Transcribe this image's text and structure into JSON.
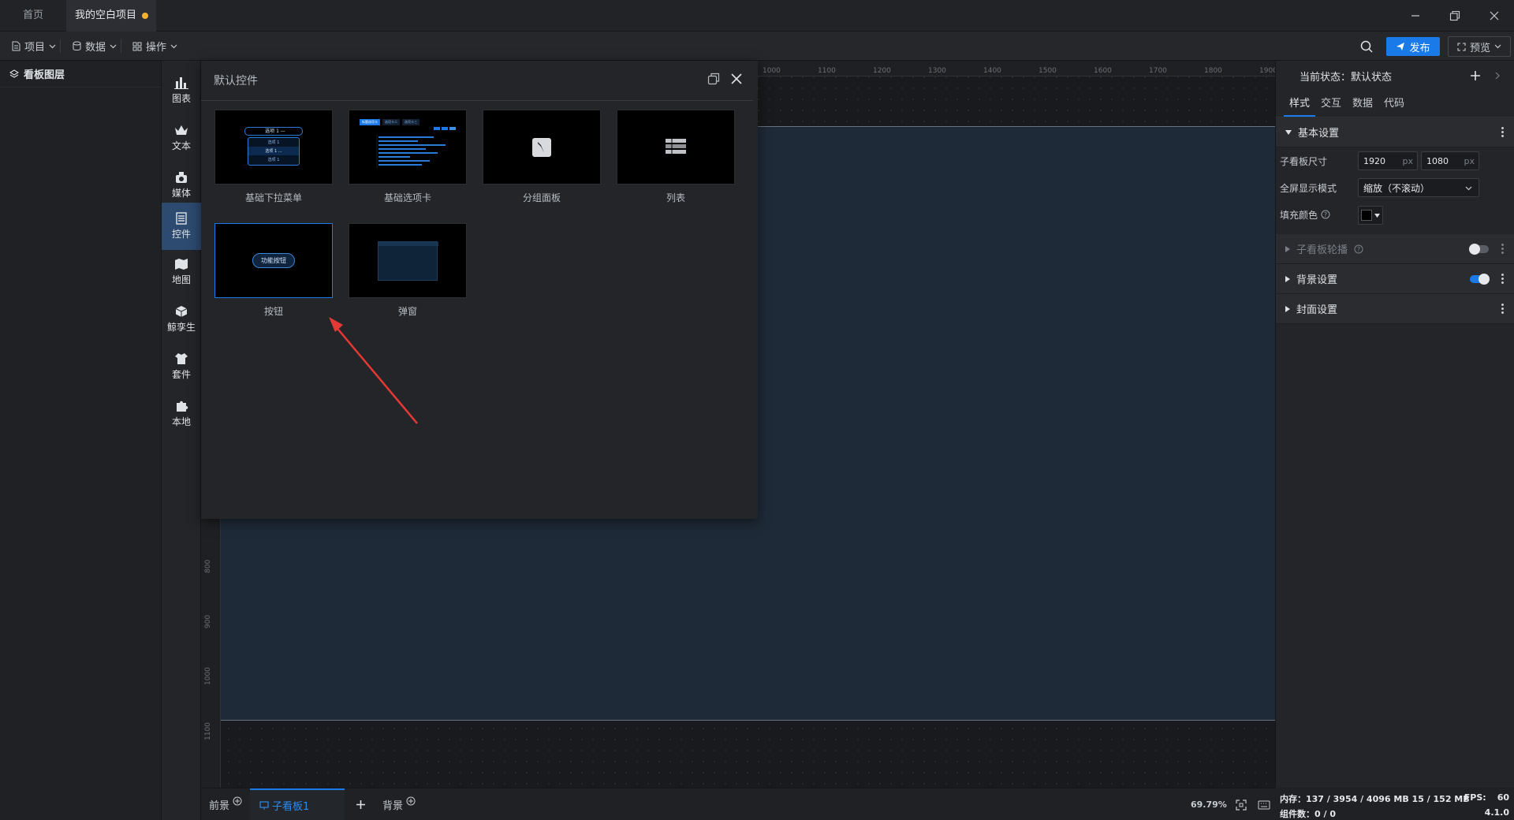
{
  "tabs": {
    "home": "首页",
    "project": "我的空白项目"
  },
  "toolbar": {
    "menus": [
      "项目",
      "数据",
      "操作"
    ],
    "publish": "发布",
    "preview": "预览"
  },
  "layers": {
    "title": "看板图层"
  },
  "sidebar": {
    "items": [
      {
        "label": "图表",
        "icon": "chart-icon"
      },
      {
        "label": "文本",
        "icon": "text-icon"
      },
      {
        "label": "媒体",
        "icon": "media-icon"
      },
      {
        "label": "控件",
        "icon": "widget-icon"
      },
      {
        "label": "地图",
        "icon": "map-icon"
      },
      {
        "label": "鲸孪生",
        "icon": "twin-icon"
      },
      {
        "label": "套件",
        "icon": "kit-icon"
      },
      {
        "label": "本地",
        "icon": "puzzle-icon"
      }
    ],
    "active_index": 3
  },
  "ruler": {
    "top": [
      "1000",
      "1100",
      "1200",
      "1300",
      "1400",
      "1500",
      "1600",
      "1700",
      "1800",
      "1900"
    ],
    "left": [
      "800",
      "900",
      "1000",
      "1100"
    ]
  },
  "popup": {
    "title": "默认控件",
    "items": [
      {
        "label": "基础下拉菜单"
      },
      {
        "label": "基础选项卡"
      },
      {
        "label": "分组面板"
      },
      {
        "label": "列表"
      },
      {
        "label": "按钮",
        "preview_text": "功能按钮"
      },
      {
        "label": "弹窗"
      }
    ],
    "dropdown_preview": [
      "选项 1 —",
      "选项 1",
      "选项 1 ...",
      "选项 1"
    ],
    "tabs_preview": [
      "标题选项卡",
      "选项卡二",
      "选项卡三"
    ]
  },
  "right": {
    "state_label": "当前状态：",
    "state_value": "默认状态",
    "tabs": [
      "样式",
      "交互",
      "数据",
      "代码"
    ],
    "basic_section": "基本设置",
    "size_label": "子看板尺寸",
    "width": "1920",
    "height": "1080",
    "unit": "px",
    "fullscreen_label": "全屏显示模式",
    "fullscreen_value": "缩放（不滚动）",
    "fill_label": "填充颜色",
    "fill_color": "#000000",
    "carousel_section": "子看板轮播",
    "carousel_on": false,
    "background_section": "背景设置",
    "background_on": true,
    "cover_section": "封面设置"
  },
  "bottom": {
    "foreground": "前景",
    "sub_board": "子看板1",
    "background": "背景",
    "zoom": "69.79%"
  },
  "status": {
    "memory": "内存：137 / 3954 / 4096 MB  15 / 152 MB",
    "fps_label": "FPS:",
    "fps": "60",
    "components": "组件数：0 / 0",
    "version": "4.1.0"
  },
  "colors": {
    "accent": "#1a7ae8",
    "board": "#1f2a38",
    "arrow": "#e53935"
  }
}
